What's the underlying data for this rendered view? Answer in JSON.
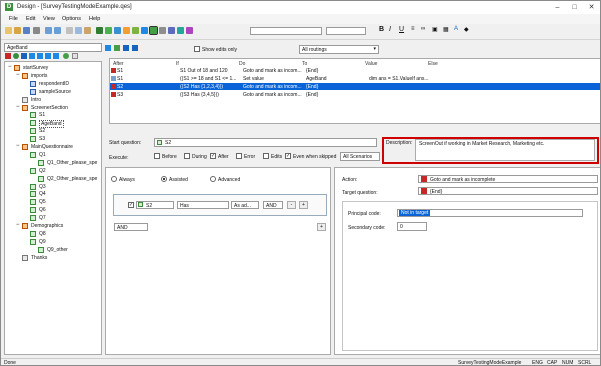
{
  "window": {
    "title": "Design - [SurveyTestingModeExample.qes]"
  },
  "menu": [
    "File",
    "Edit",
    "View",
    "Options",
    "Help"
  ],
  "toolbar": {
    "combo1": "",
    "combo2": ""
  },
  "nav": {
    "current": "AgeBand"
  },
  "tree": [
    {
      "label": "startSurvey",
      "type": "section",
      "lv": 0
    },
    {
      "label": "imports",
      "type": "section",
      "lv": 1
    },
    {
      "label": "respondentID",
      "type": "data",
      "lv": 2
    },
    {
      "label": "sampleSource",
      "type": "data",
      "lv": 2
    },
    {
      "label": "Intro",
      "type": "box",
      "lv": 1
    },
    {
      "label": "ScreenerSection",
      "type": "section",
      "lv": 1
    },
    {
      "label": "S1",
      "type": "q",
      "lv": 2
    },
    {
      "label": "AgeBand",
      "type": "q",
      "lv": 2
    },
    {
      "label": "S2",
      "type": "q",
      "lv": 2
    },
    {
      "label": "S3",
      "type": "q",
      "lv": 2
    },
    {
      "label": "MainQuestionnaire",
      "type": "section",
      "lv": 1
    },
    {
      "label": "Q1",
      "type": "q",
      "lv": 2
    },
    {
      "label": "Q1_Other_please_spe",
      "type": "q",
      "lv": 3
    },
    {
      "label": "Q2",
      "type": "q",
      "lv": 2
    },
    {
      "label": "Q2_Other_please_spe",
      "type": "q",
      "lv": 3
    },
    {
      "label": "Q3",
      "type": "q",
      "lv": 2
    },
    {
      "label": "Q4",
      "type": "q",
      "lv": 2
    },
    {
      "label": "Q5",
      "type": "q",
      "lv": 2
    },
    {
      "label": "Q6",
      "type": "q",
      "lv": 2
    },
    {
      "label": "Q7",
      "type": "q",
      "lv": 2
    },
    {
      "label": "Demographics",
      "type": "section",
      "lv": 1
    },
    {
      "label": "Q8",
      "type": "q",
      "lv": 2
    },
    {
      "label": "Q9",
      "type": "q",
      "lv": 2
    },
    {
      "label": "Q9_other",
      "type": "q",
      "lv": 3
    },
    {
      "label": "Thanks",
      "type": "box",
      "lv": 1
    }
  ],
  "routing": {
    "show_edits_only": "Show edits only",
    "filter": "All routings",
    "headers": [
      "After",
      "If",
      "Do",
      "To",
      "Value",
      "Else"
    ],
    "rows": [
      {
        "after": "S1",
        "if": "S1 Out of 18 and 120",
        "do": "Goto and mark as incom...",
        "to": "{End}",
        "value": "",
        "else": ""
      },
      {
        "after": "S1",
        "if": "((S1 >= 18 and S1 <= 1...",
        "do": "Set value",
        "to": "AgeBand",
        "value": "dim ans = S1.ValueIf ans...",
        "else": ""
      },
      {
        "after": "S2",
        "if": "((S2 Has {1,2,3,4}))",
        "do": "Goto and mark as incom...",
        "to": "{End}",
        "value": "",
        "else": ""
      },
      {
        "after": "S3",
        "if": "((S3 Has {3,4,5}))",
        "do": "Goto and mark as incom...",
        "to": "{End}",
        "value": "",
        "else": ""
      }
    ]
  },
  "detail": {
    "start_question_label": "Start question:",
    "start_question": "S2",
    "execute_label": "Execute:",
    "execute_opts": [
      "Before",
      "During",
      "After",
      "Error",
      "Edits",
      "Even when skipped"
    ],
    "execute_checked": [
      false,
      false,
      true,
      false,
      false,
      true
    ],
    "scenarios": "All Scenarios",
    "description_label": "Description:",
    "description": "ScreenOut if working in Market Research, Marketing etc.",
    "mode": [
      "Always",
      "Assisted",
      "Advanced"
    ],
    "cond": {
      "q": "S2",
      "op": "Has",
      "vals": "As ad...",
      "join": "AND",
      "minus": "-",
      "plus": "+"
    },
    "cond2": {
      "join": "AND",
      "plus": "+"
    },
    "action_label": "Action:",
    "action": "Goto and mark as incomplete",
    "target_label": "Target question:",
    "target": "{End}",
    "principal_label": "Principal code:",
    "principal": "Not in target",
    "secondary_label": "Secondary code:",
    "secondary": "0"
  },
  "status": {
    "left": "Done",
    "file": "SurveyTestingModeExample",
    "lang": "ENG",
    "cap": "CAP",
    "num": "NUM",
    "scrl": "SCRL"
  },
  "colors": {
    "highlight": "#d00000",
    "selection": "#0a64d8"
  }
}
